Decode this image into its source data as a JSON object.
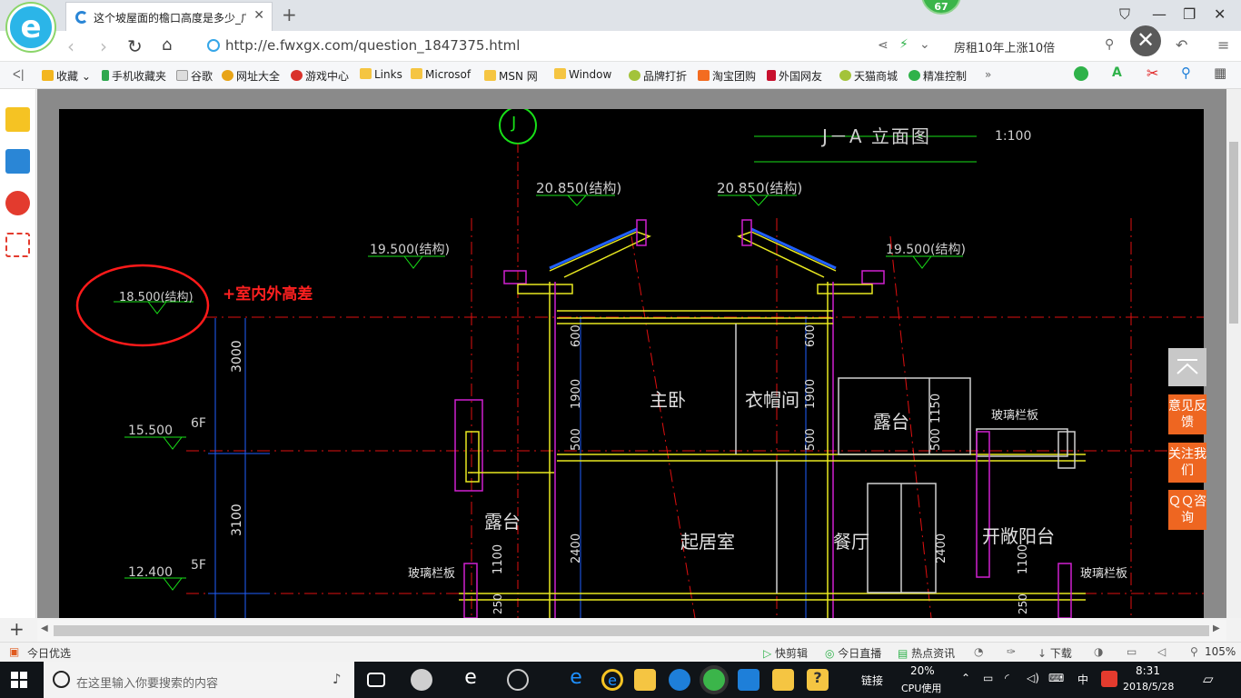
{
  "browser": {
    "logo_letter": "e",
    "tab_title": "这个坡屋面的檐口高度是多少_广",
    "badge_count": "67",
    "url": "http://e.fwxgx.com/question_1847375.html",
    "search_text": "房租10年上涨10倍"
  },
  "bookmarks": [
    {
      "label": "收藏",
      "icon": "star-icon"
    },
    {
      "label": "手机收藏夹",
      "icon": "phone-icon"
    },
    {
      "label": "谷歌",
      "icon": "page-icon"
    },
    {
      "label": "网址大全",
      "icon": "globe-icon"
    },
    {
      "label": "游戏中心",
      "icon": "game-icon"
    },
    {
      "label": "Links",
      "icon": "folder-icon"
    },
    {
      "label": "Microsof",
      "icon": "folder-icon"
    },
    {
      "label": "MSN 网",
      "icon": "folder-icon"
    },
    {
      "label": "Window",
      "icon": "folder-icon"
    },
    {
      "label": "品牌打折",
      "icon": "leaf-icon"
    },
    {
      "label": "淘宝团购",
      "icon": "taobao-icon"
    },
    {
      "label": "外国网友",
      "icon": "bookmark-icon"
    },
    {
      "label": "天猫商城",
      "icon": "leaf-icon"
    },
    {
      "label": "精准控制",
      "icon": "wechat-icon"
    }
  ],
  "drawing": {
    "title": "J－A 立面图",
    "scale": "1:100",
    "axis_label": "J",
    "elevations": {
      "top_left": "20.850(结构)",
      "top_right": "20.850(结构)",
      "eave_left": "19.500(结构)",
      "eave_right": "19.500(结构)",
      "circled": "18.500(结构)",
      "level_6f": "15.500",
      "level_5f": "12.400"
    },
    "floors": {
      "f6": "6F",
      "f5": "5F"
    },
    "dimensions": {
      "d3000": "3000",
      "d3100": "3100",
      "d600a": "600",
      "d1900a": "1900",
      "d500a": "500",
      "d600b": "600",
      "d1900b": "1900",
      "d500b": "500",
      "d2400a": "2400",
      "d2400b": "2400",
      "d1150": "1150",
      "d500c": "500",
      "d1100a": "1100",
      "d1100b": "1100",
      "d250a": "250",
      "d250b": "250"
    },
    "rooms": {
      "master": "主卧",
      "closet": "衣帽间",
      "terrace_upper": "露台",
      "terrace_lower": "露台",
      "living": "起居室",
      "dining": "餐厅",
      "balcony": "开敞阳台"
    },
    "labels": {
      "glass_rail_1": "玻璃栏板",
      "glass_rail_2": "玻璃栏板",
      "glass_rail_3": "玻璃栏板"
    },
    "annotation": "+室内外高差"
  },
  "float_buttons": {
    "feedback": "意见反馈",
    "follow": "关注我们",
    "qq": "ＱＱ咨询"
  },
  "statusbar": {
    "left": "今日优选",
    "items": [
      "快剪辑",
      "今日直播",
      "热点资讯",
      "下载"
    ],
    "zoom": "105%"
  },
  "taskbar": {
    "search_placeholder": "在这里输入你要搜索的内容",
    "link_label": "链接",
    "cpu_percent": "20%",
    "cpu_label": "CPU使用",
    "ime": "中",
    "time": "8:31",
    "date": "2018/5/28"
  },
  "colors": {
    "accent_orange": "#ee6621",
    "cad_bg": "#000000",
    "annotation_red": "#ff2020"
  }
}
